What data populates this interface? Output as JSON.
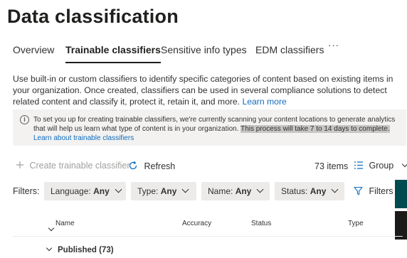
{
  "page": {
    "title": "Data classification"
  },
  "tabs": [
    {
      "label": "Overview",
      "active": false
    },
    {
      "label": "Trainable classifiers",
      "active": true
    },
    {
      "label": "Sensitive info types",
      "active": false
    },
    {
      "label": "EDM classifiers",
      "active": false
    },
    {
      "label": "···",
      "active": false
    }
  ],
  "description": {
    "text": "Use built-in or custom classifiers to identify specific categories of content based on existing items in your organization. Once created, classifiers can be used in several compliance solutions to detect related content and classify it, protect it, retain it, and more.",
    "link": "Learn more"
  },
  "banner": {
    "icon": "info-icon",
    "text_before": "To set you up for creating trainable classifiers, we're currently scanning your content locations to generate analytics that will help us learn what type of content is in your organization.",
    "highlight": "This process will take 7 to 14 days to complete.",
    "link": "Learn about trainable classifiers"
  },
  "commandbar": {
    "create_label": "Create trainable classifier",
    "refresh_label": "Refresh",
    "item_count": "73 items",
    "group_label": "Group"
  },
  "filters": {
    "label": "Filters:",
    "items": [
      {
        "name": "Language:",
        "value": "Any"
      },
      {
        "name": "Type:",
        "value": "Any"
      },
      {
        "name": "Name:",
        "value": "Any"
      },
      {
        "name": "Status:",
        "value": "Any"
      }
    ],
    "filters_button": "Filters"
  },
  "table": {
    "columns": [
      "Name",
      "Accuracy",
      "Status",
      "Type"
    ],
    "groups": [
      {
        "label": "Published (73)"
      }
    ]
  },
  "colors": {
    "accent": "#0f6cbd",
    "banner_bg": "#f3f2f1",
    "pill_bg": "#edebe9",
    "side_tab": "#004b50"
  }
}
